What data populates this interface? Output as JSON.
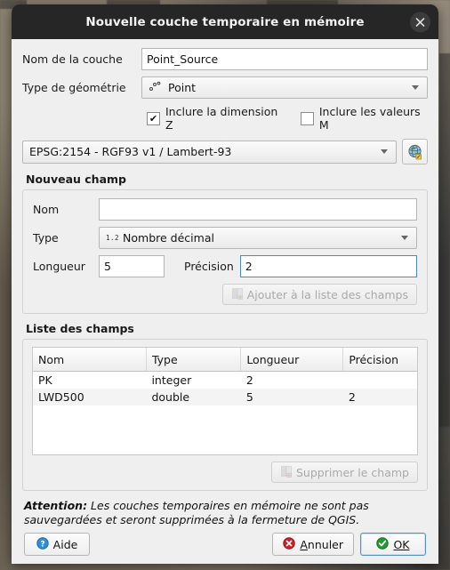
{
  "window": {
    "title": "Nouvelle couche temporaire en mémoire",
    "close_icon": "close-icon"
  },
  "form": {
    "layer_name_label": "Nom de la couche",
    "layer_name_value": "Point_Source",
    "layer_name_placeholder": "",
    "geometry_type_label": "Type de géométrie",
    "geometry_type_value": "Point",
    "geometry_type_icon": "point-geometry-icon",
    "include_z_label": "Inclure la dimension Z",
    "include_z_checked": true,
    "include_z_mark": "✔",
    "include_m_label": "Inclure les valeurs M",
    "include_m_checked": false,
    "include_m_mark": "",
    "crs_value": "EPSG:2154 - RGF93 v1 / Lambert-93",
    "crs_button_icon": "select-crs-icon"
  },
  "new_field": {
    "group_title": "Nouveau champ",
    "name_label": "Nom",
    "name_value": "",
    "name_placeholder": "",
    "type_label": "Type",
    "type_value": "Nombre décimal",
    "type_icon_text": "1.2",
    "length_label": "Longueur",
    "length_value": "5",
    "precision_label": "Précision",
    "precision_value": "2",
    "add_button_label": "Ajouter à la liste des champs",
    "add_button_enabled": false
  },
  "field_list": {
    "group_title": "Liste des champs",
    "columns": [
      "Nom",
      "Type",
      "Longueur",
      "Précision"
    ],
    "rows": [
      [
        "PK",
        "integer",
        "2",
        ""
      ],
      [
        "LWD500",
        "double",
        "5",
        "2"
      ]
    ],
    "delete_button_label": "Supprimer le champ",
    "delete_button_enabled": false
  },
  "warning": {
    "bold_prefix": "Attention:",
    "text": " Les couches temporaires en mémoire ne sont pas sauvegardées et seront supprimées à la fermeture de QGIS."
  },
  "footer": {
    "help_label": "Aide",
    "help_icon": "help-icon",
    "cancel_label_pre": "",
    "cancel_label_accel": "A",
    "cancel_label_post": "nnuler",
    "cancel_icon": "cancel-icon",
    "ok_label_accel": "OK",
    "ok_icon": "ok-icon",
    "ok_focused": true
  },
  "colors": {
    "titlebar": "#262626",
    "dialog_bg": "#efefef",
    "accent_focus": "#4a88c7",
    "cancel_red": "#cc2229",
    "ok_green": "#1f9b34",
    "help_blue": "#2e90d8"
  }
}
